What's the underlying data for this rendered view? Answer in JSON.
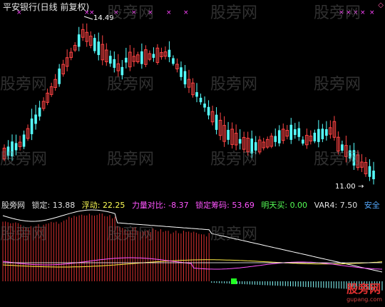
{
  "title": "平安银行(日线 前复权)",
  "corner_marker": "◇",
  "price_labels": {
    "high": "14.49",
    "low": "11.00",
    "low_arrow": "→"
  },
  "indicator": {
    "name": "股旁网",
    "items": [
      {
        "label": "锁定:",
        "value": "13.88",
        "color": "#e0e0e0"
      },
      {
        "label": "浮动:",
        "value": "22.25",
        "color": "#ffff55"
      },
      {
        "label": "力量对比:",
        "value": "-8.37",
        "color": "#ff55ff"
      },
      {
        "label": "锁定筹码:",
        "value": "53.69",
        "color": "#ff55ff"
      },
      {
        "label": "明天买:",
        "value": "0.00",
        "color": "#55ff55"
      },
      {
        "label": "VAR4:",
        "value": "7.50",
        "color": "#e0e0e0"
      },
      {
        "label": "安全",
        "value": "",
        "color": "#55aaff"
      }
    ]
  },
  "watermark_text": "股旁网",
  "logo": {
    "name": "股旁网",
    "url": "gupang.com"
  },
  "colors": {
    "up": "#ff4444",
    "down": "#55ffff",
    "bg": "#000000"
  }
}
